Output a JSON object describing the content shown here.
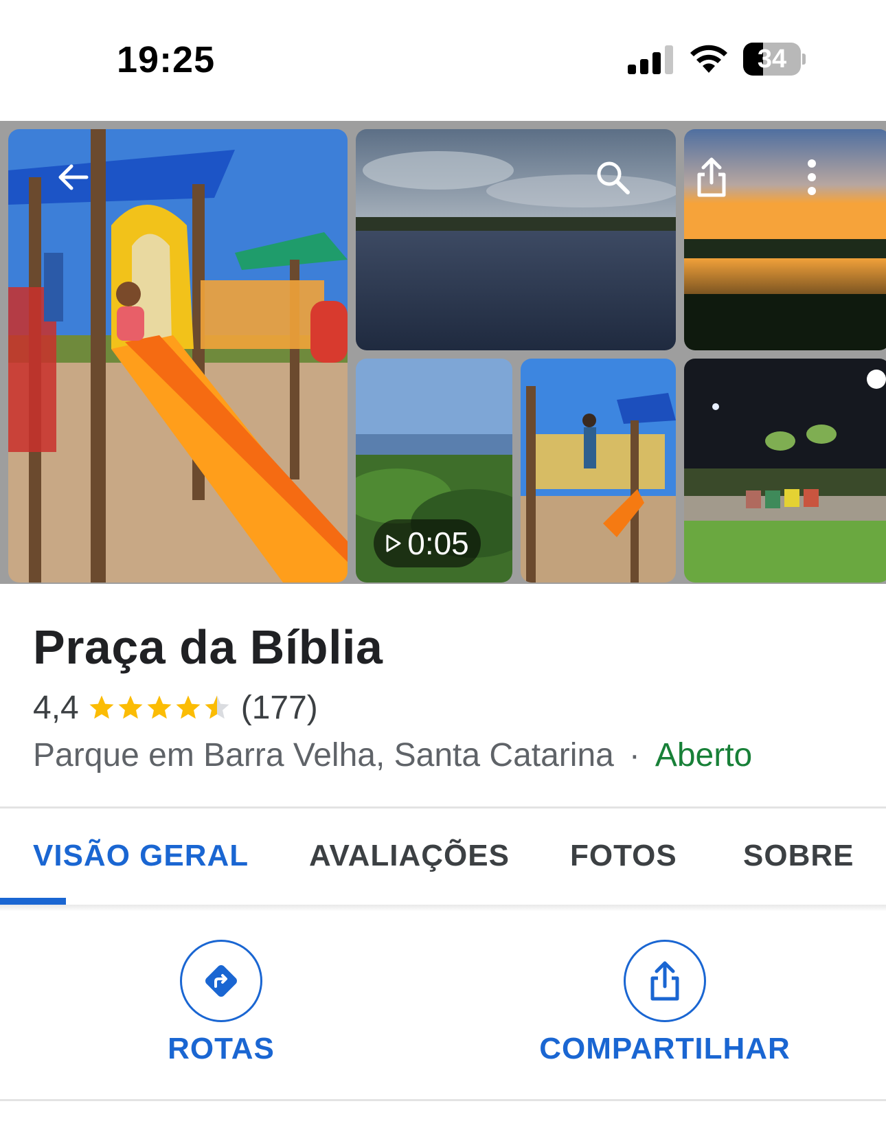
{
  "status_bar": {
    "time": "19:25",
    "battery_level": "34",
    "signal_bars_filled": 3,
    "signal_bars_total": 4,
    "icons": [
      "signal-icon",
      "wifi-icon",
      "battery-icon"
    ]
  },
  "gallery": {
    "video_duration": "0:05",
    "overlay_icons": [
      "back-arrow-icon",
      "search-icon",
      "share-icon",
      "more-vert-icon"
    ]
  },
  "place": {
    "title": "Praça da Bíblia",
    "rating": "4,4",
    "rating_value": 4.4,
    "rating_max": 5,
    "review_count": "(177)",
    "category": "Parque em Barra Velha, Santa Catarina",
    "separator": "·",
    "open_status": "Aberto"
  },
  "tabs": [
    {
      "label": "VISÃO GERAL",
      "active": true
    },
    {
      "label": "AVALIAÇÕES",
      "active": false
    },
    {
      "label": "FOTOS",
      "active": false
    },
    {
      "label": "SOBRE",
      "active": false
    }
  ],
  "actions": {
    "directions_label": "ROTAS",
    "share_label": "COMPARTILHAR"
  },
  "colors": {
    "accent": "#1a66d2",
    "star": "#fbbc04",
    "open": "#188038"
  }
}
